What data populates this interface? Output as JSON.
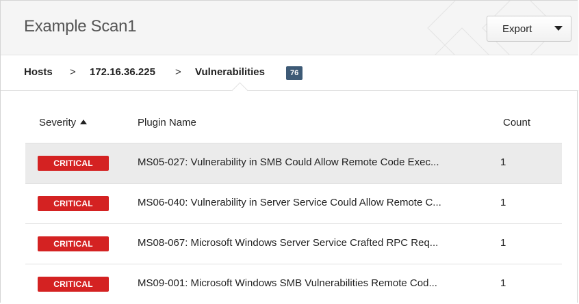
{
  "header": {
    "title": "Example Scan1",
    "export_label": "Export"
  },
  "breadcrumb": {
    "items": [
      "Hosts",
      "172.16.36.225",
      "Vulnerabilities"
    ],
    "separator": ">",
    "vuln_count": "76"
  },
  "table": {
    "columns": [
      "Severity",
      "Plugin Name",
      "Count"
    ],
    "sort": {
      "column": "Severity",
      "direction": "ascending"
    },
    "rows": [
      {
        "severity": "CRITICAL",
        "plugin": "MS05-027: Vulnerability in SMB Could Allow Remote Code Exec...",
        "count": "1"
      },
      {
        "severity": "CRITICAL",
        "plugin": "MS06-040: Vulnerability in Server Service Could Allow Remote C...",
        "count": "1"
      },
      {
        "severity": "CRITICAL",
        "plugin": "MS08-067: Microsoft Windows Server Service Crafted RPC Req...",
        "count": "1"
      },
      {
        "severity": "CRITICAL",
        "plugin": "MS09-001: Microsoft Windows SMB Vulnerabilities Remote Cod...",
        "count": "1"
      }
    ]
  },
  "colors": {
    "critical": "#d42222",
    "badge": "#3d5a76",
    "header_bg": "#f5f5f5",
    "row_highlight": "#ebebeb"
  },
  "icons": [
    "caret-down-icon",
    "sort-ascending-icon"
  ]
}
